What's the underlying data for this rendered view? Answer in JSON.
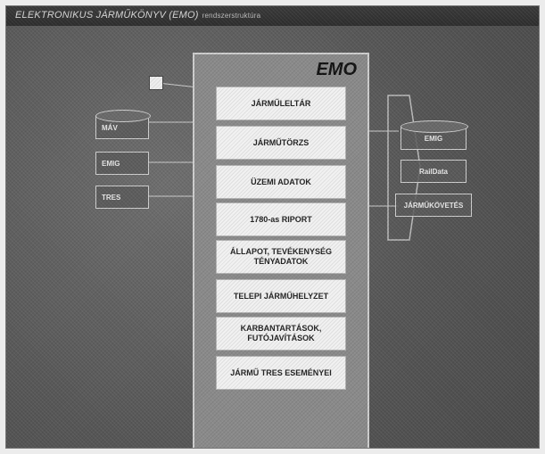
{
  "header": {
    "title": "ELEKTRONIKUS JÁRMŰKÖNYV (EMO)",
    "subtitle": "rendszerstruktúra"
  },
  "core": {
    "label": "EMO",
    "modules": [
      "JÁRMŰLELTÁR",
      "JÁRMŰTÖRZS",
      "ÜZEMI ADATOK",
      "1780-as RIPORT",
      "ÁLLAPOT, TEVÉKENYSÉG TÉNYADATOK",
      "TELEPI JÁRMŰHELYZET",
      "KARBANTARTÁSOK, FUTÓJAVÍTÁSOK",
      "JÁRMŰ TRES ESEMÉNYEI"
    ]
  },
  "inputs": [
    "MÁV",
    "EMIG",
    "TRES"
  ],
  "outputs": [
    "EMIG",
    "RailData",
    "JÁRMŰKÖVETÉS"
  ],
  "colors": {
    "background": "#555555",
    "panel": "#8a8a8a",
    "module": "#f1f1f1"
  }
}
